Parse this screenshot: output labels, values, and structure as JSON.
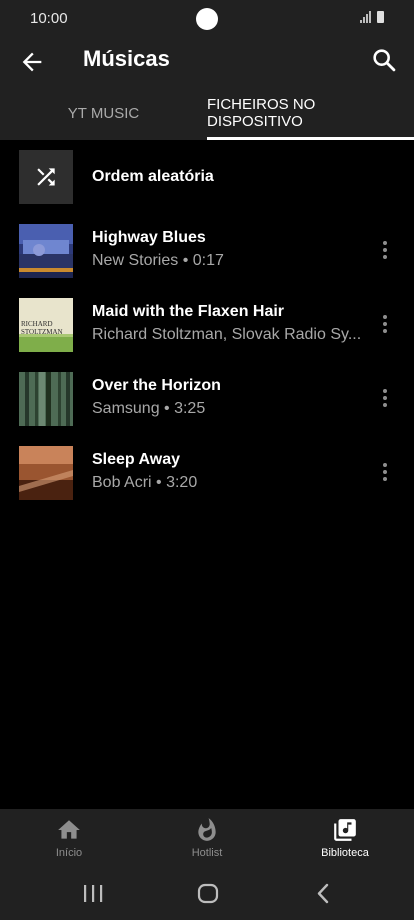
{
  "status": {
    "time": "10:00"
  },
  "app_bar": {
    "title": "Músicas",
    "back_icon": "arrow-left-icon",
    "search_icon": "search-icon"
  },
  "tabs": [
    {
      "label": "YT MUSIC",
      "active": false
    },
    {
      "label": "FICHEIROS NO DISPOSITIVO",
      "active": true
    }
  ],
  "shuffle": {
    "label": "Ordem aleatória",
    "icon": "shuffle-icon"
  },
  "tracks": [
    {
      "title": "Highway Blues",
      "subtitle": "New Stories • 0:17"
    },
    {
      "title": "Maid with the Flaxen Hair",
      "subtitle": "Richard Stoltzman, Slovak Radio Sy...",
      "art_text": "RICHARD STOLTZMAN"
    },
    {
      "title": "Over the Horizon",
      "subtitle": "Samsung • 3:25"
    },
    {
      "title": "Sleep Away",
      "subtitle": "Bob Acri • 3:20"
    }
  ],
  "bottom_nav": [
    {
      "label": "Início",
      "icon": "home-icon",
      "active": false
    },
    {
      "label": "Hotlist",
      "icon": "flame-icon",
      "active": false
    },
    {
      "label": "Biblioteca",
      "icon": "library-icon",
      "active": true
    }
  ],
  "colors": {
    "bar_bg": "#212121",
    "background": "#000000",
    "secondary_text": "#a8a8a8"
  }
}
